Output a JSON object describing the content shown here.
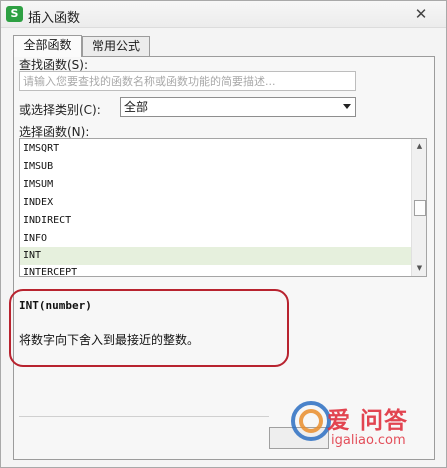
{
  "window": {
    "title": "插入函数",
    "app_icon_letter": "S",
    "close_glyph": "✕"
  },
  "tabs": [
    {
      "label": "全部函数",
      "active": true
    },
    {
      "label": "常用公式",
      "active": false
    }
  ],
  "search": {
    "label": "查找函数(S):",
    "placeholder": "请输入您要查找的函数名称或函数功能的简要描述...",
    "value": ""
  },
  "category": {
    "label": "或选择类别(C):",
    "selected": "全部"
  },
  "function_list": {
    "label": "选择函数(N):",
    "items": [
      "IMSQRT",
      "IMSUB",
      "IMSUM",
      "INDEX",
      "INDIRECT",
      "INFO",
      "INT",
      "INTERCEPT"
    ],
    "selected": "INT"
  },
  "scrollbar": {
    "up_glyph": "▲",
    "down_glyph": "▼"
  },
  "description": {
    "syntax": "INT(number)",
    "text": "将数字向下舍入到最接近的整数。"
  },
  "watermark": {
    "main": "爱 问答",
    "url": "igaliao.com"
  },
  "colors": {
    "highlight_border": "#b8232f",
    "selected_row": "#e6f0dd",
    "app_icon": "#2ea043"
  }
}
